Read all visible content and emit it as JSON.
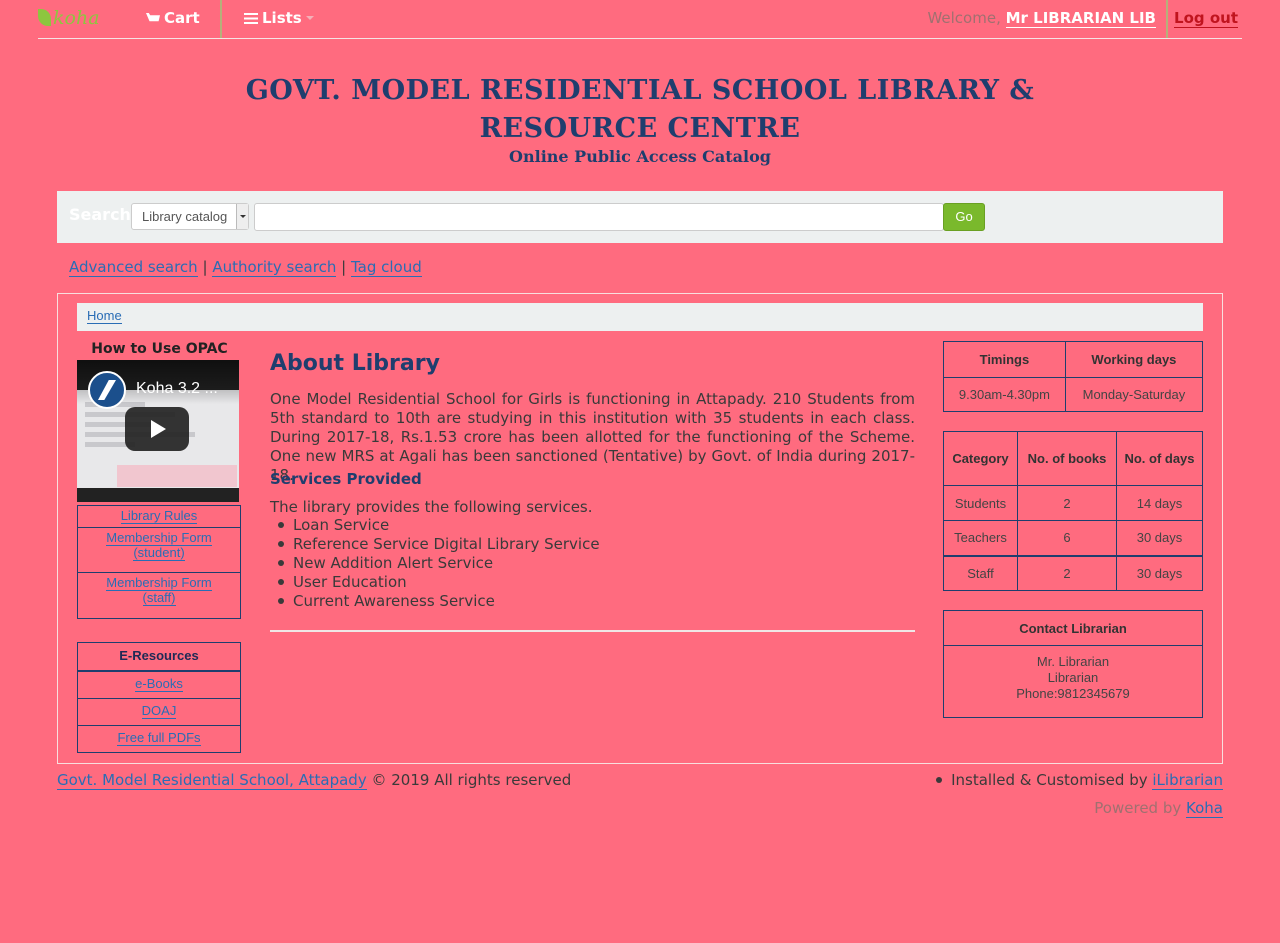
{
  "nav": {
    "logo": "koha",
    "cart": "Cart",
    "lists": "Lists",
    "welcome": "Welcome,",
    "username": "Mr LIBRARIAN LIB",
    "logout": "Log out"
  },
  "header": {
    "line1": "GOVT. MODEL RESIDENTIAL SCHOOL  LIBRARY &",
    "line2": "RESOURCE CENTRE",
    "line3": "Online Public Access Catalog"
  },
  "search": {
    "label": "Search",
    "scope": "Library catalog",
    "query": "",
    "go": "Go"
  },
  "links": {
    "advanced": "Advanced search",
    "authority": "Authority search",
    "tags": "Tag cloud",
    "sep": "|"
  },
  "breadcrumb": {
    "home": "Home"
  },
  "left": {
    "opac_heading": "How to Use OPAC",
    "video_title": "Koha 3.2 ...",
    "rules": [
      "Library Rules",
      "Membership Form (student)",
      "Membership Form (staff)"
    ],
    "eresources_heading": "E-Resources",
    "eresources": [
      "e-Books",
      "DOAJ",
      "Free full PDFs"
    ]
  },
  "about": {
    "title": "About Library",
    "text": "One Model Residential School for Girls is functioning in Attapady. 210 Students from 5th standard to 10th are studying in this institution with 35 students in each class. During 2017-18, Rs.1.53 crore has been allotted for the functioning of the Scheme. One new MRS at Agali has been sanctioned (Tentative) by Govt. of India during 2017-18.",
    "services_title": "Services Provided",
    "services_intro": "The library provides the following services.",
    "services": [
      "Loan Service",
      "Reference Service Digital Library Service",
      "New Addition Alert Service",
      "User Education",
      "Current Awareness Service"
    ]
  },
  "timings": {
    "headers": [
      "Timings",
      "Working days"
    ],
    "values": [
      "9.30am-4.30pm",
      "Monday-Saturday"
    ]
  },
  "loans": {
    "headers": [
      "Category",
      "No. of books",
      "No. of days"
    ],
    "rows": [
      [
        "Students",
        "2",
        "14 days"
      ],
      [
        "Teachers",
        "6",
        "30 days"
      ],
      [
        "Staff",
        "2",
        "30 days"
      ]
    ]
  },
  "contact": {
    "heading": "Contact Librarian",
    "name": "Mr. Librarian",
    "role": "Librarian",
    "phone": "Phone:9812345679"
  },
  "footer": {
    "school": "Govt. Model Residential School, Attapady",
    "rights": "© 2019 All rights reserved",
    "installed": "Installed & Customised by",
    "installer": "iLibrarian",
    "powered": "Powered by",
    "koha": "Koha"
  }
}
